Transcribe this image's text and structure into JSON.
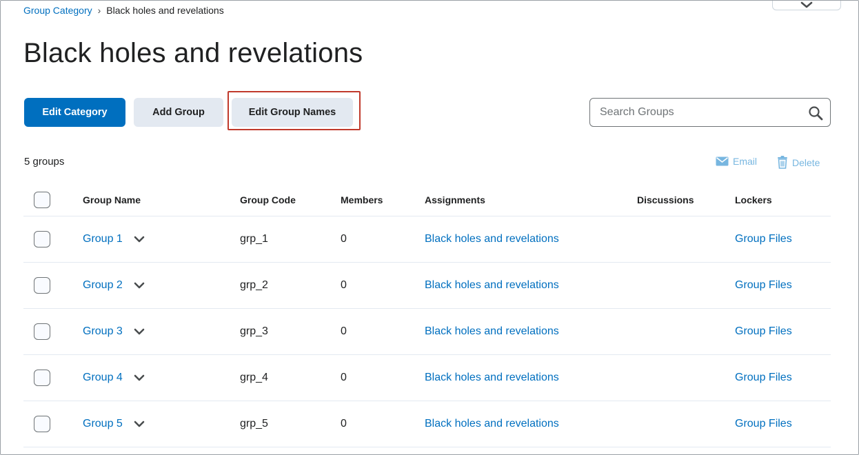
{
  "breadcrumb": {
    "parent": "Group Category",
    "separator": "›",
    "current": "Black holes and revelations"
  },
  "page_title": "Black holes and revelations",
  "toolbar": {
    "edit_category": "Edit Category",
    "add_group": "Add Group",
    "edit_group_names": "Edit Group Names"
  },
  "search": {
    "placeholder": "Search Groups"
  },
  "summary": {
    "count_label": "5 groups"
  },
  "actions": {
    "email": "Email",
    "delete": "Delete"
  },
  "table": {
    "headers": {
      "name": "Group Name",
      "code": "Group Code",
      "members": "Members",
      "assignments": "Assignments",
      "discussions": "Discussions",
      "lockers": "Lockers"
    },
    "rows": [
      {
        "name": "Group 1",
        "code": "grp_1",
        "members": "0",
        "assignment": "Black holes and revelations",
        "locker": "Group Files"
      },
      {
        "name": "Group 2",
        "code": "grp_2",
        "members": "0",
        "assignment": "Black holes and revelations",
        "locker": "Group Files"
      },
      {
        "name": "Group 3",
        "code": "grp_3",
        "members": "0",
        "assignment": "Black holes and revelations",
        "locker": "Group Files"
      },
      {
        "name": "Group 4",
        "code": "grp_4",
        "members": "0",
        "assignment": "Black holes and revelations",
        "locker": "Group Files"
      },
      {
        "name": "Group 5",
        "code": "grp_5",
        "members": "0",
        "assignment": "Black holes and revelations",
        "locker": "Group Files"
      }
    ]
  },
  "colors": {
    "primary": "#006fbf",
    "link": "#006fbf",
    "disabled_action": "#77b6e0",
    "secondary_button": "#e3e9f1",
    "highlight": "#c0392b"
  },
  "icons": {
    "search": "search-icon",
    "email": "envelope-icon",
    "delete": "trash-icon",
    "expand": "chevron-down-icon"
  }
}
